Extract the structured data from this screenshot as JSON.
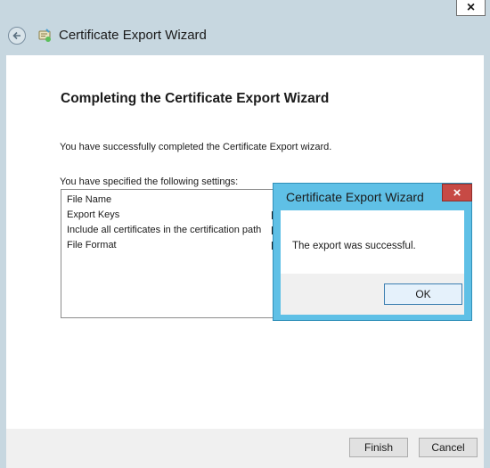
{
  "wizard": {
    "title": "Certificate Export Wizard",
    "heading": "Completing the Certificate Export Wizard",
    "success_text": "You have successfully completed the Certificate Export wizard.",
    "settings_label": "You have specified the following settings:",
    "settings_rows": [
      "File Name",
      "Export Keys",
      "Include all certificates in the certification path",
      "File Format"
    ],
    "finish_label": "Finish",
    "cancel_label": "Cancel"
  },
  "window": {
    "close_icon": "×"
  },
  "dialog": {
    "title": "Certificate Export Wizard",
    "message": "The export was successful.",
    "ok_label": "OK",
    "close_icon": "×"
  },
  "colors": {
    "window_chrome": "#c7d7e0",
    "dialog_frame": "#5fc0e6",
    "dialog_close": "#c74a45"
  }
}
